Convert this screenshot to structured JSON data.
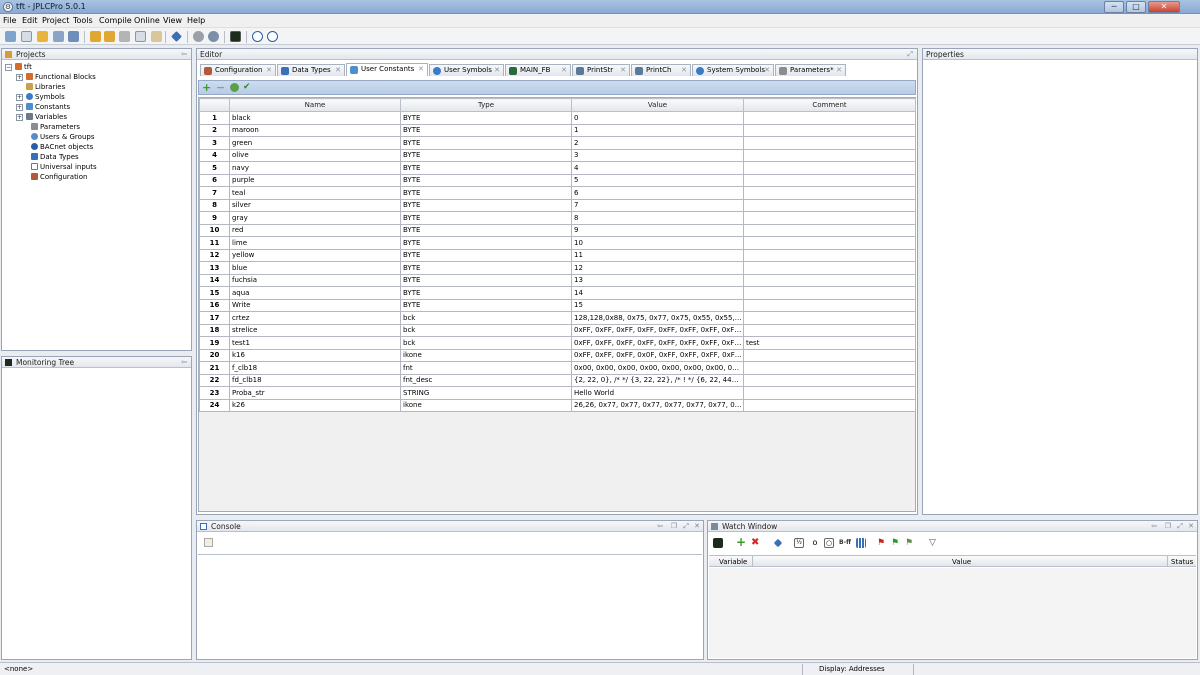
{
  "window": {
    "title": "tft - JPLCPro 5.0.1",
    "minimize": "─",
    "maximize": "□",
    "close": "✕"
  },
  "menu": [
    "File",
    "Edit",
    "Project",
    "Tools",
    "Compile",
    "Online",
    "View",
    "Help"
  ],
  "projects": {
    "title": "Projects",
    "root": "tft",
    "items": [
      "Functional Blocks",
      "Libraries",
      "Symbols",
      "Constants",
      "Variables",
      "Parameters",
      "Users & Groups",
      "BACnet objects",
      "Data Types",
      "Universal inputs",
      "Configuration"
    ]
  },
  "monitoring": {
    "title": "Monitoring Tree"
  },
  "editor": {
    "title": "Editor"
  },
  "properties": {
    "title": "Properties"
  },
  "tabs": [
    "Configuration",
    "Data Types",
    "User Constants",
    "User Symbols",
    "MAIN_FB",
    "PrintStr",
    "PrintCh",
    "System Symbols",
    "Parameters*"
  ],
  "table": {
    "columns": [
      "Name",
      "Type",
      "Value",
      "Comment"
    ],
    "rows": [
      [
        "1",
        "black",
        "BYTE",
        "0",
        ""
      ],
      [
        "2",
        "maroon",
        "BYTE",
        "1",
        ""
      ],
      [
        "3",
        "green",
        "BYTE",
        "2",
        ""
      ],
      [
        "4",
        "olive",
        "BYTE",
        "3",
        ""
      ],
      [
        "5",
        "navy",
        "BYTE",
        "4",
        ""
      ],
      [
        "6",
        "purple",
        "BYTE",
        "5",
        ""
      ],
      [
        "7",
        "teal",
        "BYTE",
        "6",
        ""
      ],
      [
        "8",
        "silver",
        "BYTE",
        "7",
        ""
      ],
      [
        "9",
        "gray",
        "BYTE",
        "8",
        ""
      ],
      [
        "10",
        "red",
        "BYTE",
        "9",
        ""
      ],
      [
        "11",
        "lime",
        "BYTE",
        "10",
        ""
      ],
      [
        "12",
        "yellow",
        "BYTE",
        "11",
        ""
      ],
      [
        "13",
        "blue",
        "BYTE",
        "12",
        ""
      ],
      [
        "14",
        "fuchsia",
        "BYTE",
        "13",
        ""
      ],
      [
        "15",
        "aqua",
        "BYTE",
        "14",
        ""
      ],
      [
        "16",
        "Write",
        "BYTE",
        "15",
        ""
      ],
      [
        "17",
        "crtez",
        "bck",
        "128,128,0x88, 0x75, 0x77, 0x75, 0x55, 0x55, 0x57,...",
        ""
      ],
      [
        "18",
        "strelice",
        "bck",
        "0xFF, 0xFF, 0xFF, 0xFF, 0xFF, 0xFF, 0xFF, 0xFF, 0x...",
        ""
      ],
      [
        "19",
        "test1",
        "bck",
        "0xFF, 0xFF, 0xFF, 0xFF, 0xFF, 0xFF, 0xFF, 0xFF, 0x...",
        "test"
      ],
      [
        "20",
        "k16",
        "ikone",
        "0xFF, 0xFF, 0xFF, 0x0F, 0xFF, 0xFF, 0xFF, 0xFF, 0x...",
        ""
      ],
      [
        "21",
        "f_clb18",
        "fnt",
        "0x00, 0x00, 0x00, 0x00, 0x00, 0x00, 0x00, 0x00, 0x...",
        ""
      ],
      [
        "22",
        "fd_clb18",
        "fnt_desc",
        "{2, 22, 0}, /*  */ {3, 22, 22}, /* ! */ {6, 22, 44}, /* \"...",
        ""
      ],
      [
        "23",
        "Proba_str",
        "STRING",
        "Hello World",
        ""
      ],
      [
        "24",
        "k26",
        "ikone",
        "26,26, 0x77, 0x77, 0x77, 0x77, 0x77, 0x77, 0x77, ...",
        ""
      ]
    ]
  },
  "console": {
    "title": "Console"
  },
  "watch": {
    "title": "Watch Window",
    "columns": [
      "Variable",
      "Value",
      "Status"
    ],
    "tool_label": "B-ff"
  },
  "status": {
    "left": "<none>",
    "display": "Display: Addresses"
  },
  "colors": {
    "title_bar": "#8aa9d2",
    "grid_toolbar": "#b8cbe6",
    "accent_green": "#3a9a2a"
  }
}
